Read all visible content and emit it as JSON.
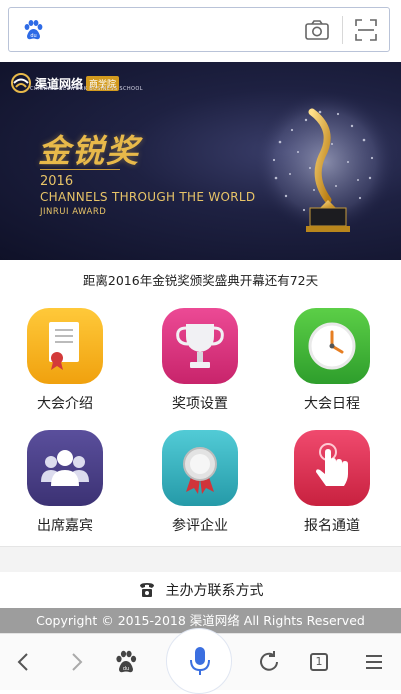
{
  "search_bar": {
    "logo_icon": "baidu-paw-icon",
    "camera_icon": "camera-icon",
    "scan_icon": "scan-icon"
  },
  "banner": {
    "brand_name": "渠道网络",
    "brand_tag": "商学院",
    "brand_sub": "CHANNEL NETWORK BUSINESS SCHOOL",
    "award_title": "金锐奖",
    "year": "2016",
    "headline": "CHANNELS THROUGH THE WORLD",
    "subline": "JINRUI  AWARD"
  },
  "countdown": "距离2016年金锐奖颁奖盛典开幕还有72天",
  "menu": [
    {
      "label": "大会介绍",
      "icon": "document-certificate-icon",
      "color": "#f4b41a"
    },
    {
      "label": "奖项设置",
      "icon": "trophy-icon",
      "color": "#d9317d"
    },
    {
      "label": "大会日程",
      "icon": "clock-icon",
      "color": "#3fb43c"
    },
    {
      "label": "出席嘉宾",
      "icon": "guests-icon",
      "color": "#4a3f86"
    },
    {
      "label": "参评企业",
      "icon": "medal-icon",
      "color": "#3bb8c4"
    },
    {
      "label": "报名通道",
      "icon": "touch-hand-icon",
      "color": "#e0305a"
    }
  ],
  "contact": {
    "icon": "telephone-icon",
    "label": "主办方联系方式"
  },
  "copyright": "Copyright © 2015-2018 渠道网络 All Rights Reserved",
  "bottom_bar": {
    "back_icon": "chevron-left-icon",
    "forward_icon": "chevron-right-icon",
    "home_icon": "baidu-paw-icon",
    "voice_icon": "microphone-icon",
    "refresh_icon": "refresh-icon",
    "tabs_icon": "tabs-icon",
    "tabs_count": "1",
    "menu_icon": "menu-icon"
  },
  "colors": {
    "accent": "#3b6fe0",
    "banner_gold": "#e8b94a"
  }
}
